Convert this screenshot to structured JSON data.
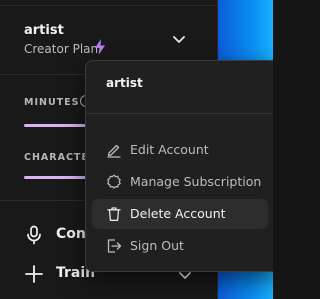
{
  "user": {
    "name": "artist",
    "plan": "Creator Plan"
  },
  "usage": {
    "minutes_label": "MINUTES",
    "characters_label": "CHARACTE",
    "minutes_fill_percent": 98,
    "characters_fill_percent": 98
  },
  "nav": {
    "convert_label": "Con",
    "train_label": "Train"
  },
  "menu": {
    "user_name": "artist",
    "items": [
      {
        "label": "Edit Account",
        "icon": "pencil-icon"
      },
      {
        "label": "Manage Subscription",
        "icon": "gear-icon"
      },
      {
        "label": "Delete Account",
        "icon": "trash-icon"
      },
      {
        "label": "Sign Out",
        "icon": "sign-out-icon"
      }
    ]
  },
  "colors": {
    "accent_purple": "#d9b4f3",
    "bolt": "#b77cf2",
    "sidebar_bg": "#191919",
    "menu_bg": "#202020",
    "brand_blue": "#0a8cf0"
  }
}
